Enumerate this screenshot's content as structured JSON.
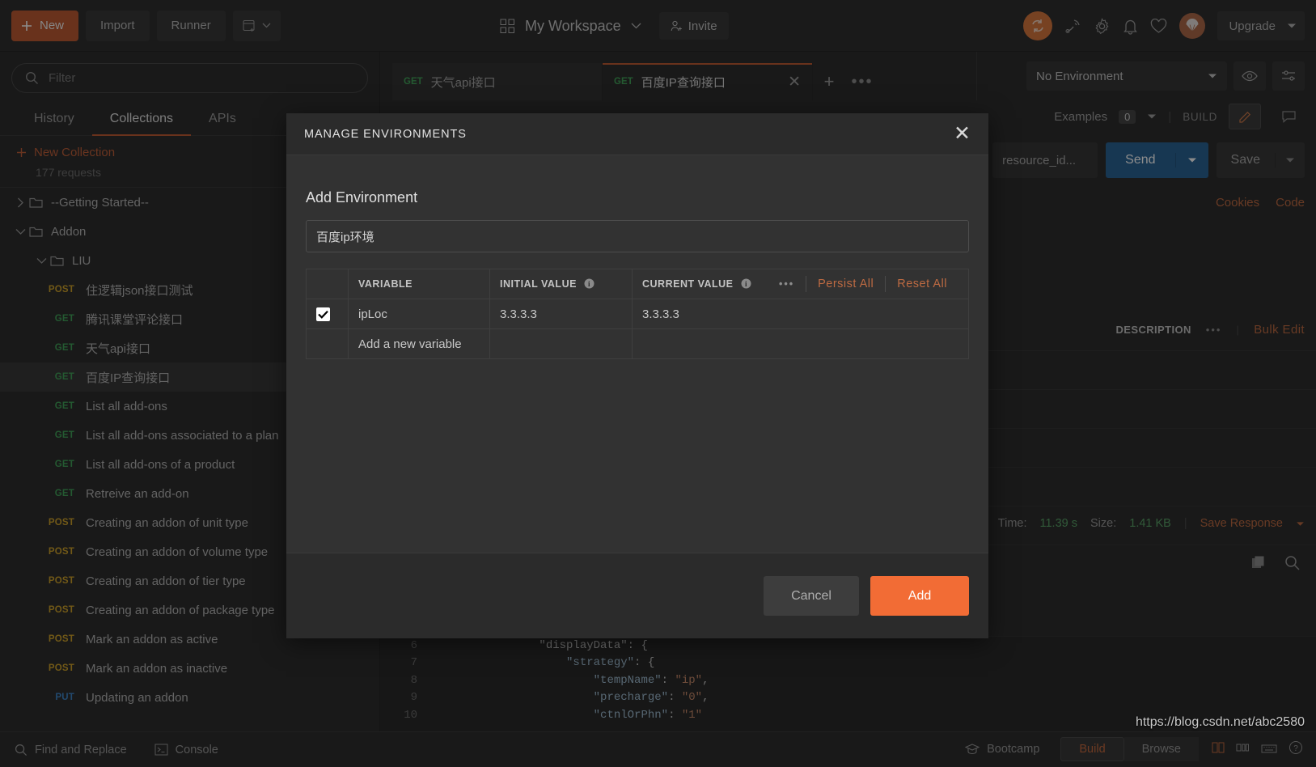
{
  "topbar": {
    "new_label": "New",
    "import_label": "Import",
    "runner_label": "Runner",
    "workspace_name": "My Workspace",
    "invite_label": "Invite",
    "upgrade_label": "Upgrade",
    "icons": [
      "sync-icon",
      "satellite-icon",
      "gear-icon",
      "bell-icon",
      "heart-icon",
      "parachute-icon"
    ]
  },
  "sidebar": {
    "filter_placeholder": "Filter",
    "tabs": [
      {
        "label": "History",
        "active": false
      },
      {
        "label": "Collections",
        "active": true
      },
      {
        "label": "APIs",
        "active": false
      }
    ],
    "new_collection_label": "New Collection",
    "request_count": "177 requests",
    "tree": [
      {
        "type": "folder",
        "label": "--Getting Started--",
        "depth": 0,
        "expanded": false
      },
      {
        "type": "folder",
        "label": "Addon",
        "depth": 0,
        "expanded": true
      },
      {
        "type": "folder",
        "label": "LIU",
        "depth": 1,
        "expanded": true
      },
      {
        "type": "request",
        "method": "POST",
        "label": "住逻辑json接口测试",
        "selected": false
      },
      {
        "type": "request",
        "method": "GET",
        "label": "腾讯课堂评论接口",
        "selected": false
      },
      {
        "type": "request",
        "method": "GET",
        "label": "天气api接口",
        "selected": false
      },
      {
        "type": "request",
        "method": "GET",
        "label": "百度IP查询接口",
        "selected": true
      },
      {
        "type": "request",
        "method": "GET",
        "label": "List all add-ons",
        "selected": false
      },
      {
        "type": "request",
        "method": "GET",
        "label": "List all add-ons associated to a plan",
        "selected": false
      },
      {
        "type": "request",
        "method": "GET",
        "label": "List all add-ons of a product",
        "selected": false
      },
      {
        "type": "request",
        "method": "GET",
        "label": "Retreive an add-on",
        "selected": false
      },
      {
        "type": "request",
        "method": "POST",
        "label": "Creating an addon of unit type",
        "selected": false
      },
      {
        "type": "request",
        "method": "POST",
        "label": "Creating an addon of volume type",
        "selected": false
      },
      {
        "type": "request",
        "method": "POST",
        "label": "Creating an addon of tier type",
        "selected": false
      },
      {
        "type": "request",
        "method": "POST",
        "label": "Creating an addon of package type",
        "selected": false
      },
      {
        "type": "request",
        "method": "POST",
        "label": "Mark an addon as active",
        "selected": false
      },
      {
        "type": "request",
        "method": "POST",
        "label": "Mark an addon as inactive",
        "selected": false
      },
      {
        "type": "request",
        "method": "PUT",
        "label": "Updating an addon",
        "selected": false
      }
    ]
  },
  "statusbar": {
    "find_replace": "Find and Replace",
    "console": "Console",
    "bootcamp": "Bootcamp",
    "build": "Build",
    "browse": "Browse"
  },
  "main": {
    "request_tabs": [
      {
        "method": "GET",
        "label": "天气api接口",
        "active": false
      },
      {
        "method": "GET",
        "label": "百度IP查询接口",
        "active": true
      }
    ],
    "environment_selected": "No Environment",
    "examples_label": "Examples",
    "examples_count": "0",
    "build_label": "BUILD",
    "url_value": "resource_id...",
    "send_label": "Send",
    "save_label": "Save",
    "cookies_label": "Cookies",
    "code_label": "Code",
    "description_header": "DESCRIPTION",
    "bulk_edit_label": "Bulk Edit",
    "time_label": "Time:",
    "time_value": "11.39 s",
    "size_label": "Size:",
    "size_value": "1.41 KB",
    "save_response_label": "Save Response"
  },
  "code": {
    "lines": [
      {
        "num": "6",
        "indent": 4,
        "text": "\"displayData\": {"
      },
      {
        "num": "7",
        "indent": 5,
        "key": "\"strategy\"",
        "rest": ": {"
      },
      {
        "num": "8",
        "indent": 6,
        "key": "\"tempName\"",
        "sep": ": ",
        "val": "\"ip\"",
        "tail": ","
      },
      {
        "num": "9",
        "indent": 6,
        "key": "\"precharge\"",
        "sep": ": ",
        "val": "\"0\"",
        "tail": ","
      },
      {
        "num": "10",
        "indent": 6,
        "key": "\"ctnlOrPhn\"",
        "sep": ": ",
        "val": "\"1\"",
        "tail": ""
      }
    ]
  },
  "modal": {
    "title": "MANAGE ENVIRONMENTS",
    "section_title": "Add Environment",
    "env_name_value": "百度ip环境",
    "table": {
      "headers": [
        "VARIABLE",
        "INITIAL VALUE",
        "CURRENT VALUE"
      ],
      "actions": {
        "dots": "•••",
        "persist_all": "Persist All",
        "reset_all": "Reset All"
      },
      "rows": [
        {
          "checked": true,
          "variable": "ipLoc",
          "initial": "3.3.3.3",
          "current": "3.3.3.3"
        }
      ],
      "new_row_placeholder": "Add a new variable"
    },
    "cancel_label": "Cancel",
    "add_label": "Add"
  },
  "watermark": "https://blog.csdn.net/abc2580",
  "colors": {
    "accent_orange": "#f26c35",
    "brand_orange": "#c05c33",
    "link_orange": "#bd6a42",
    "send_blue": "#2a6496",
    "get_green": "#42a35a",
    "post_yellow": "#cfa32b",
    "put_blue": "#3f86c9"
  }
}
